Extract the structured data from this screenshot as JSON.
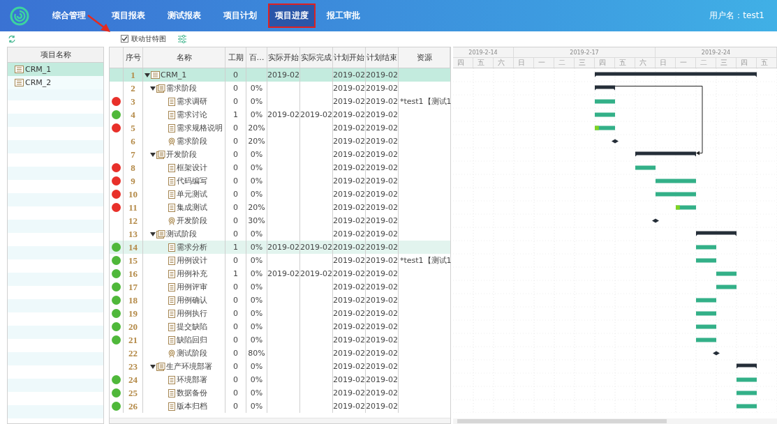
{
  "nav": {
    "tabs": [
      {
        "label": "综合管理",
        "selected": false
      },
      {
        "label": "项目报表",
        "selected": false
      },
      {
        "label": "测试报表",
        "selected": false
      },
      {
        "label": "项目计划",
        "selected": false
      },
      {
        "label": "项目进度",
        "selected": true
      },
      {
        "label": "报工审批",
        "selected": false
      }
    ],
    "user": "用户名：test1"
  },
  "toolbar": {
    "gantt_link": {
      "label": "联动甘特图",
      "checked": true
    }
  },
  "projects": {
    "header": "项目名称",
    "items": [
      {
        "name": "CRM_1",
        "selected": true
      },
      {
        "name": "CRM_2",
        "selected": false
      }
    ]
  },
  "grid": {
    "columns": [
      "序号",
      "名称",
      "工期",
      "百…",
      "实际开始",
      "实际完成",
      "计划开始",
      "计划结束",
      "资源"
    ],
    "rows": [
      {
        "kind": "project",
        "num": "1",
        "name": "CRM_1",
        "duration": "0",
        "actual_start": "2019-02",
        "plan_start": "2019-02",
        "plan_end": "2019-02",
        "selected": true,
        "hovered": false,
        "expanded": true,
        "children": [
          {
            "kind": "phase",
            "num": "2",
            "name": "需求阶段",
            "duration": "0",
            "percent": "0%",
            "plan_start": "2019-02",
            "plan_end": "2019-02",
            "selected": false,
            "hovered": false,
            "expanded": true,
            "children": [
              {
                "kind": "task",
                "num": "3",
                "name": "需求调研",
                "duration": "0",
                "percent": "0%",
                "plan_start": "2019-02",
                "plan_end": "2019-02",
                "resource": "*test1【测试1",
                "color": "#e8302a",
                "selected": false,
                "hovered": false
              },
              {
                "kind": "task",
                "num": "4",
                "name": "需求讨论",
                "duration": "1",
                "percent": "0%",
                "actual_start": "2019-02",
                "actual_end": "2019-02",
                "plan_start": "2019-02",
                "plan_end": "2019-02",
                "color": "#4fb83a",
                "selected": false,
                "hovered": false
              },
              {
                "kind": "task",
                "num": "5",
                "name": "需求规格说明",
                "duration": "0",
                "percent": "20%",
                "level": 0.2,
                "plan_start": "2019-02",
                "plan_end": "2019-02",
                "color": "#e8302a",
                "selected": false,
                "hovered": false
              },
              {
                "kind": "milestone",
                "num": "6",
                "name": "需求阶段",
                "duration": "0",
                "percent": "20%",
                "plan_start": "2019-02",
                "plan_end": "2019-02",
                "selected": false,
                "hovered": false
              }
            ]
          },
          {
            "kind": "phase",
            "num": "7",
            "name": "开发阶段",
            "duration": "0",
            "percent": "0%",
            "plan_start": "2019-02",
            "plan_end": "2019-02",
            "selected": false,
            "hovered": false,
            "expanded": true,
            "children": [
              {
                "kind": "task",
                "num": "8",
                "name": "框架设计",
                "duration": "0",
                "percent": "0%",
                "plan_start": "2019-02",
                "plan_end": "2019-02",
                "color": "#e8302a",
                "selected": false,
                "hovered": false
              },
              {
                "kind": "task",
                "num": "9",
                "name": "代码编写",
                "duration": "0",
                "percent": "0%",
                "plan_start": "2019-02",
                "plan_end": "2019-02",
                "color": "#e8302a",
                "selected": false,
                "hovered": false
              },
              {
                "kind": "task",
                "num": "10",
                "name": "单元测试",
                "duration": "0",
                "percent": "0%",
                "plan_start": "2019-02",
                "plan_end": "2019-02",
                "color": "#e8302a",
                "selected": false,
                "hovered": false
              },
              {
                "kind": "task",
                "num": "11",
                "name": "集成测试",
                "duration": "0",
                "percent": "20%",
                "level": 0.2,
                "plan_start": "2019-02",
                "plan_end": "2019-02",
                "color": "#e8302a",
                "selected": false,
                "hovered": false
              },
              {
                "kind": "milestone",
                "num": "12",
                "name": "开发阶段",
                "duration": "0",
                "percent": "30%",
                "plan_start": "2019-02",
                "plan_end": "2019-02",
                "selected": false,
                "hovered": false
              }
            ]
          },
          {
            "kind": "phase",
            "num": "13",
            "name": "测试阶段",
            "duration": "0",
            "percent": "0%",
            "plan_start": "2019-02",
            "plan_end": "2019-02",
            "selected": false,
            "hovered": false,
            "expanded": true,
            "children": [
              {
                "kind": "task",
                "num": "14",
                "name": "需求分析",
                "duration": "1",
                "percent": "0%",
                "actual_start": "2019-02",
                "actual_end": "2019-02",
                "plan_start": "2019-02",
                "plan_end": "2019-02",
                "color": "#4fb83a",
                "selected": false,
                "hovered": true
              },
              {
                "kind": "task",
                "num": "15",
                "name": "用例设计",
                "duration": "0",
                "percent": "0%",
                "plan_start": "2019-02",
                "plan_end": "2019-02",
                "resource": "*test1【测试1",
                "color": "#4fb83a",
                "selected": false,
                "hovered": false
              },
              {
                "kind": "task",
                "num": "16",
                "name": "用例补充",
                "duration": "1",
                "percent": "0%",
                "actual_start": "2019-02",
                "actual_end": "2019-02",
                "plan_start": "2019-02",
                "plan_end": "2019-02",
                "color": "#4fb83a",
                "selected": false,
                "hovered": false
              },
              {
                "kind": "task",
                "num": "17",
                "name": "用例评审",
                "duration": "0",
                "percent": "0%",
                "plan_start": "2019-02",
                "plan_end": "2019-02",
                "color": "#4fb83a",
                "selected": false,
                "hovered": false
              },
              {
                "kind": "task",
                "num": "18",
                "name": "用例确认",
                "duration": "0",
                "percent": "0%",
                "plan_start": "2019-02",
                "plan_end": "2019-02",
                "color": "#4fb83a",
                "selected": false,
                "hovered": false
              },
              {
                "kind": "task",
                "num": "19",
                "name": "用例执行",
                "duration": "0",
                "percent": "0%",
                "plan_start": "2019-02",
                "plan_end": "2019-02",
                "color": "#4fb83a",
                "selected": false,
                "hovered": false
              },
              {
                "kind": "task",
                "num": "20",
                "name": "提交缺陷",
                "duration": "0",
                "percent": "0%",
                "plan_start": "2019-02",
                "plan_end": "2019-02",
                "color": "#4fb83a",
                "selected": false,
                "hovered": false
              },
              {
                "kind": "task",
                "num": "21",
                "name": "缺陷回归",
                "duration": "0",
                "percent": "0%",
                "plan_start": "2019-02",
                "plan_end": "2019-02",
                "color": "#4fb83a",
                "selected": false,
                "hovered": false
              },
              {
                "kind": "milestone",
                "num": "22",
                "name": "测试阶段",
                "duration": "0",
                "percent": "80%",
                "plan_start": "2019-02",
                "plan_end": "2019-02",
                "selected": false,
                "hovered": false
              }
            ]
          },
          {
            "kind": "phase",
            "num": "23",
            "name": "生产环境部署",
            "duration": "0",
            "percent": "0%",
            "plan_start": "2019-02",
            "plan_end": "2019-02",
            "selected": false,
            "hovered": false,
            "expanded": true,
            "children": [
              {
                "kind": "task",
                "num": "24",
                "name": "环境部署",
                "duration": "0",
                "percent": "0%",
                "plan_start": "2019-02",
                "plan_end": "2019-02",
                "color": "#4fb83a",
                "selected": false,
                "hovered": false
              },
              {
                "kind": "task",
                "num": "25",
                "name": "数据备份",
                "duration": "0",
                "percent": "0%",
                "plan_start": "2019-02",
                "plan_end": "2019-02",
                "color": "#4fb83a",
                "selected": false,
                "hovered": false
              },
              {
                "kind": "task",
                "num": "26",
                "name": "版本归档",
                "duration": "0",
                "percent": "0%",
                "plan_start": "2019-02",
                "plan_end": "2019-02",
                "color": "#4fb83a",
                "selected": false,
                "hovered": false
              }
            ]
          }
        ]
      }
    ]
  },
  "gantt": {
    "weeks": [
      {
        "label": "2019-2-14",
        "days": [
          "四",
          "五",
          "六"
        ]
      },
      {
        "label": "2019-2-17",
        "days": [
          "日",
          "一",
          "二",
          "三",
          "四",
          "五",
          "六"
        ]
      },
      {
        "label": "2019-2-24",
        "days": [
          "日",
          "一",
          "二",
          "三",
          "四",
          "五"
        ]
      }
    ]
  }
}
